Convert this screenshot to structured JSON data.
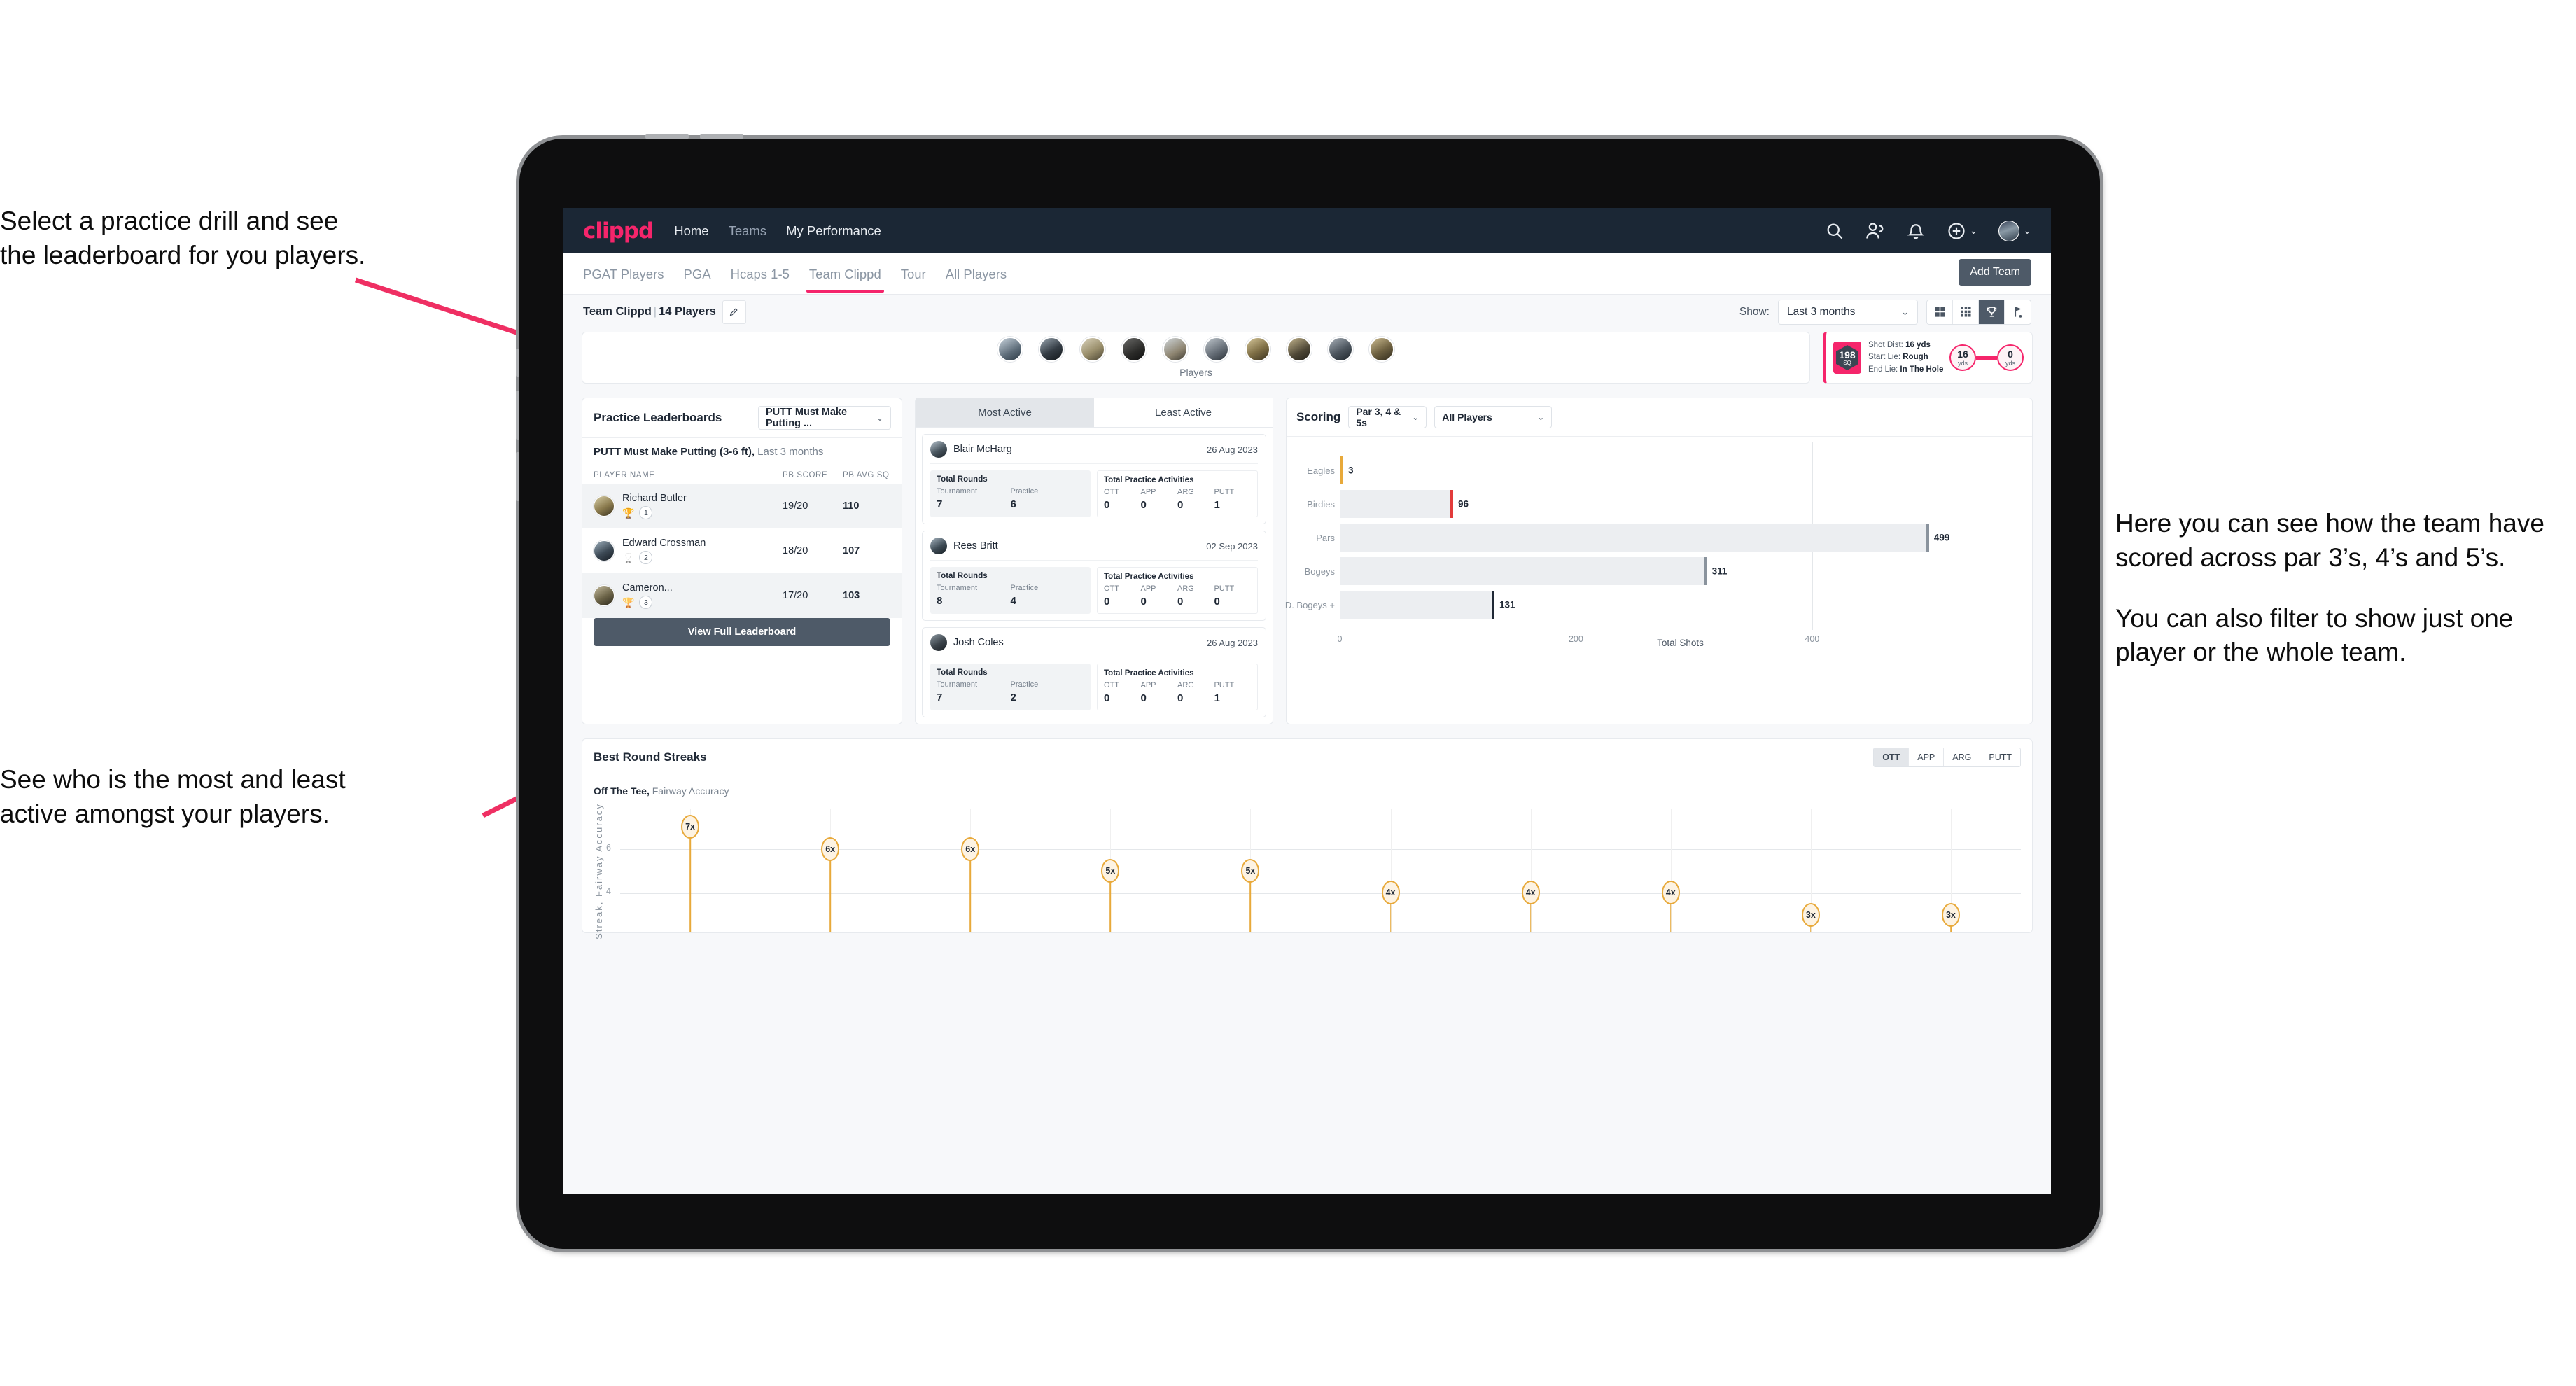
{
  "annotations": {
    "top_left": [
      "Select a practice drill and see",
      "the leaderboard for you players."
    ],
    "bottom_left": [
      "See who is the most and least",
      "active amongst your players."
    ],
    "right": [
      "Here you can see how the team have scored across par 3’s, 4’s and 5’s.",
      "You can also filter to show just one player or the whole team."
    ]
  },
  "navbar": {
    "logo": "clippd",
    "links": [
      {
        "label": "Home",
        "active": true
      },
      {
        "label": "Teams",
        "active": false
      },
      {
        "label": "My Performance",
        "active": true
      }
    ],
    "icons": [
      "search-icon",
      "people-icon",
      "bell-icon",
      "plus-circle-icon"
    ],
    "caret": "⌄"
  },
  "tabstrip": {
    "tabs": [
      {
        "label": "PGAT Players",
        "active": false
      },
      {
        "label": "PGA",
        "active": false
      },
      {
        "label": "Hcaps 1-5",
        "active": false
      },
      {
        "label": "Team Clippd",
        "active": true
      },
      {
        "label": "Tour",
        "active": false
      },
      {
        "label": "All Players",
        "active": false
      }
    ],
    "add_team": "Add Team"
  },
  "subbar": {
    "team_name": "Team Clippd",
    "separator": "|",
    "player_count": "14 Players",
    "show_label": "Show:",
    "range_value": "Last 3 months",
    "chevron": "⌄",
    "view_toggles": [
      {
        "name": "grid-large-icon",
        "active": false
      },
      {
        "name": "grid-small-icon",
        "active": false
      },
      {
        "name": "trophy-icon",
        "active": true
      },
      {
        "name": "flag-icon",
        "active": false
      }
    ]
  },
  "players_strip": {
    "label": "Players",
    "avatars": 10
  },
  "shot_card": {
    "badge_value": "198",
    "badge_unit": "SQ",
    "lines": [
      {
        "key": "Shot Dist:",
        "value": "16 yds"
      },
      {
        "key": "Start Lie:",
        "value": "Rough"
      },
      {
        "key": "End Lie:",
        "value": "In The Hole"
      }
    ],
    "start": {
      "value": "16",
      "unit": "yds"
    },
    "end": {
      "value": "0",
      "unit": "yds"
    }
  },
  "leaderboard": {
    "title": "Practice Leaderboards",
    "drill_select": "PUTT Must Make Putting ...",
    "chevron": "⌄",
    "subtitle_bold": "PUTT Must Make Putting (3-6 ft),",
    "subtitle_light": " Last 3 months",
    "columns": [
      "PLAYER NAME",
      "PB SCORE",
      "PB AVG SQ"
    ],
    "rows": [
      {
        "name": "Richard Butler",
        "trophy": "🏆",
        "rank": "1",
        "pb_score": "19/20",
        "pb_avg_sq": "110"
      },
      {
        "name": "Edward Crossman",
        "trophy": "🏆",
        "rank": "2",
        "pb_score": "18/20",
        "pb_avg_sq": "107"
      },
      {
        "name": "Cameron...",
        "trophy": "🏆",
        "rank": "3",
        "pb_score": "17/20",
        "pb_avg_sq": "103"
      }
    ],
    "view_full": "View Full Leaderboard"
  },
  "activity": {
    "tabs": [
      {
        "label": "Most Active",
        "active": true
      },
      {
        "label": "Least Active",
        "active": false
      }
    ],
    "rounds_title": "Total Rounds",
    "rounds_keys": [
      "Tournament",
      "Practice"
    ],
    "practice_title": "Total Practice Activities",
    "practice_keys": [
      "OTT",
      "APP",
      "ARG",
      "PUTT"
    ],
    "players": [
      {
        "name": "Blair McHarg",
        "date": "26 Aug 2023",
        "rounds": [
          "7",
          "6"
        ],
        "practice": [
          "0",
          "0",
          "0",
          "1"
        ]
      },
      {
        "name": "Rees Britt",
        "date": "02 Sep 2023",
        "rounds": [
          "8",
          "4"
        ],
        "practice": [
          "0",
          "0",
          "0",
          "0"
        ]
      },
      {
        "name": "Josh Coles",
        "date": "26 Aug 2023",
        "rounds": [
          "7",
          "2"
        ],
        "practice": [
          "0",
          "0",
          "0",
          "1"
        ]
      }
    ]
  },
  "scoring": {
    "title": "Scoring",
    "par_filter": "Par 3, 4 & 5s",
    "player_filter": "All Players",
    "chevron": "⌄"
  },
  "streaks": {
    "title": "Best Round Streaks",
    "toggle": [
      {
        "label": "OTT",
        "active": true
      },
      {
        "label": "APP",
        "active": false
      },
      {
        "label": "ARG",
        "active": false
      },
      {
        "label": "PUTT",
        "active": false
      }
    ],
    "subtitle_bold": "Off The Tee,",
    "subtitle_light": " Fairway Accuracy"
  },
  "colors": {
    "brand_pink": "#f5256b",
    "navy": "#1b2735",
    "slate": "#4e5a68",
    "gold": "#e8a93a"
  },
  "chart_data": [
    {
      "type": "bar",
      "orientation": "horizontal",
      "title": "Scoring",
      "categories": [
        "Eagles",
        "Birdies",
        "Pars",
        "Bogeys",
        "D. Bogeys +"
      ],
      "values": [
        3,
        96,
        499,
        311,
        131
      ],
      "tip_colors": [
        "#e8a93a",
        "#e23b3b",
        "#8a939d",
        "#8a939d",
        "#1f2835"
      ],
      "xlabel": "Total Shots",
      "ylabel": "",
      "xlim": [
        0,
        540
      ],
      "xticks": [
        0,
        200,
        400
      ],
      "grid": true,
      "legend": "none"
    },
    {
      "type": "scatter",
      "title": "Best Round Streaks",
      "subtitle": "Off The Tee, Fairway Accuracy",
      "ylabel": "Streak, Fairway Accuracy",
      "yticks": [
        4,
        6
      ],
      "ylim": [
        2.2,
        7.8
      ],
      "values": [
        7,
        6,
        6,
        5,
        5,
        4,
        4,
        4,
        3,
        3
      ],
      "labels": [
        "7x",
        "6x",
        "6x",
        "5x",
        "5x",
        "4x",
        "4x",
        "4x",
        "3x",
        "3x"
      ],
      "grid": true,
      "legend": "none"
    }
  ]
}
